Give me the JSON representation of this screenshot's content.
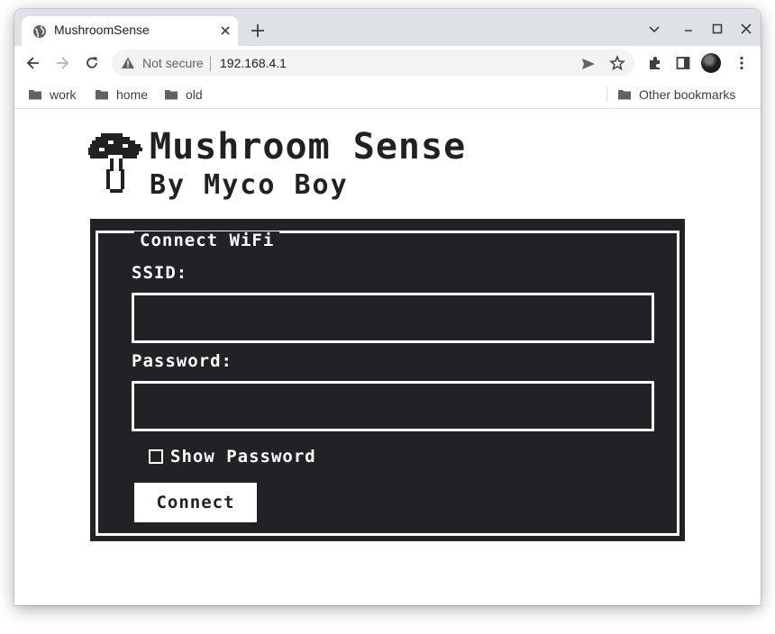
{
  "browser": {
    "tab": {
      "title": "MushroomSense"
    },
    "omnibox": {
      "security_label": "Not secure",
      "url": "192.168.4.1"
    },
    "bookmarks": [
      {
        "label": "work"
      },
      {
        "label": "home"
      },
      {
        "label": "old"
      }
    ],
    "other_bookmarks": "Other bookmarks"
  },
  "page": {
    "title": "Mushroom Sense",
    "subtitle": "By Myco Boy",
    "form": {
      "legend": "Connect WiFi",
      "ssid_label": "SSID:",
      "ssid_value": "",
      "password_label": "Password:",
      "password_value": "",
      "show_password_label": "Show Password",
      "show_password_checked": false,
      "submit_label": "Connect"
    }
  },
  "colors": {
    "panel_bg": "#202225",
    "panel_text": "#ffffff",
    "tabstrip_bg": "#dee1e6"
  }
}
